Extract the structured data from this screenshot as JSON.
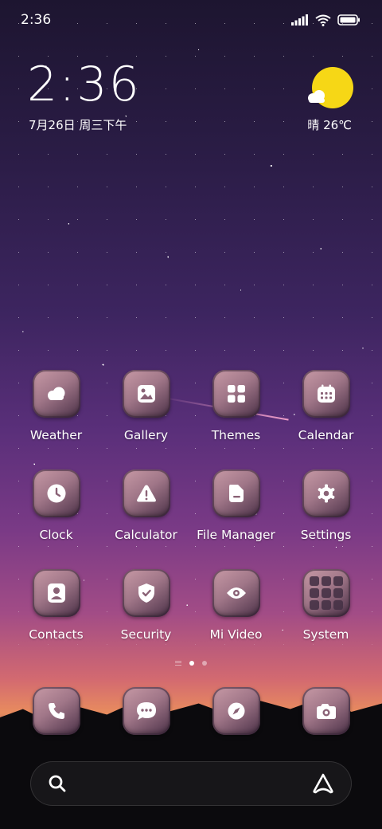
{
  "status_bar": {
    "time": "2:36"
  },
  "clock_widget": {
    "time": "2:36",
    "date": "7月26日 周三下午"
  },
  "weather_widget": {
    "text": "晴 26℃"
  },
  "apps": [
    {
      "label": "Weather",
      "icon": "cloud-icon"
    },
    {
      "label": "Gallery",
      "icon": "image-icon"
    },
    {
      "label": "Themes",
      "icon": "grid-icon"
    },
    {
      "label": "Calendar",
      "icon": "calendar-icon"
    },
    {
      "label": "Clock",
      "icon": "clock-icon"
    },
    {
      "label": "Calculator",
      "icon": "warning-icon"
    },
    {
      "label": "File Manager",
      "icon": "folder-icon"
    },
    {
      "label": "Settings",
      "icon": "gear-icon"
    },
    {
      "label": "Contacts",
      "icon": "person-icon"
    },
    {
      "label": "Security",
      "icon": "shield-icon"
    },
    {
      "label": "Mi Video",
      "icon": "eye-icon"
    },
    {
      "label": "System",
      "icon": "folder-grid-icon"
    }
  ],
  "dock": [
    {
      "icon": "phone-icon"
    },
    {
      "icon": "message-icon"
    },
    {
      "icon": "compass-icon"
    },
    {
      "icon": "camera-icon"
    }
  ],
  "page_indicator": {
    "pages": 2,
    "active": 1
  },
  "colors": {
    "sun": "#f6d716",
    "icon_bg": "#a07688",
    "text": "#ffffff"
  }
}
